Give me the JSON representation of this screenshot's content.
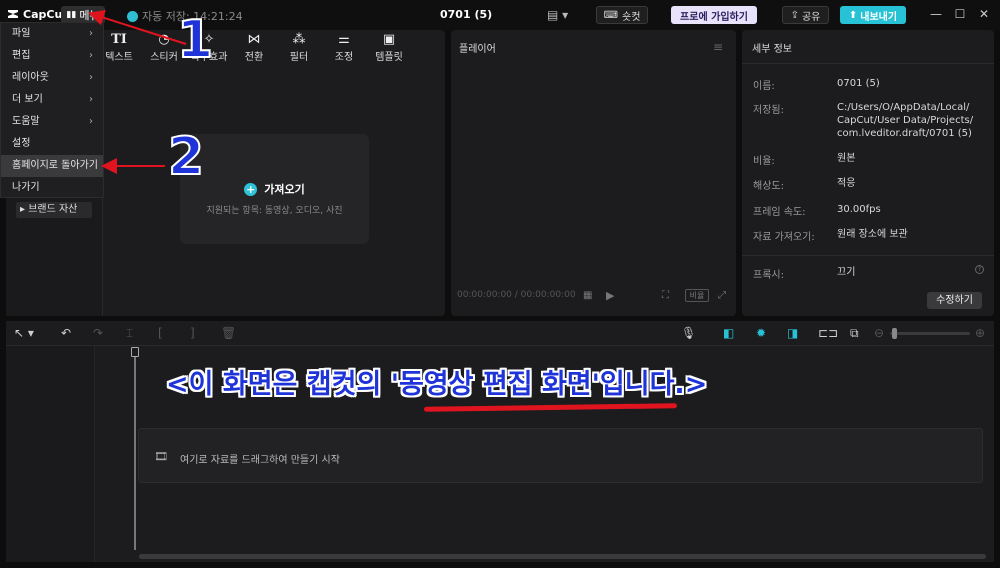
{
  "titlebar": {
    "logo": "CapCut",
    "menu_label": "메뉴",
    "autosave": "자동 저장: 14:21:24",
    "project_title": "0701 (5)",
    "shortcut_label": "숏컷",
    "pro_label": "프로에 가입하기",
    "share_label": "공유",
    "export_label": "내보내기"
  },
  "menu": {
    "items": [
      {
        "label": "파일",
        "has_sub": true
      },
      {
        "label": "편집",
        "has_sub": true
      },
      {
        "label": "레이아웃",
        "has_sub": true
      },
      {
        "label": "더 보기",
        "has_sub": true
      },
      {
        "label": "도움말",
        "has_sub": true
      },
      {
        "label": "설정",
        "has_sub": false
      },
      {
        "label": "홈페이지로 돌아가기",
        "has_sub": false
      },
      {
        "label": "나가기",
        "has_sub": false
      }
    ]
  },
  "media": {
    "tabs": [
      {
        "icon": "text-icon",
        "glyph": "TI",
        "label": "텍스트"
      },
      {
        "icon": "sticker-icon",
        "glyph": "◔",
        "label": "스티커"
      },
      {
        "icon": "effects-icon",
        "glyph": "✧",
        "label": "특수효과"
      },
      {
        "icon": "transition-icon",
        "glyph": "⋈",
        "label": "전환"
      },
      {
        "icon": "filter-icon",
        "glyph": "⁂",
        "label": "필터"
      },
      {
        "icon": "adjust-icon",
        "glyph": "⚌",
        "label": "조정"
      },
      {
        "icon": "template-icon",
        "glyph": "▣",
        "label": "템플릿"
      }
    ],
    "brand_asset": "▸ 브랜드 자산",
    "import_label": "가져오기",
    "import_hint": "지원되는 항목: 동영상, 오디오, 사진"
  },
  "player": {
    "title": "플레이어",
    "timecode": "00:00:00:00 / 00:00:00:00",
    "ratio_label": "비율"
  },
  "details": {
    "title": "세부 정보",
    "rows": [
      {
        "key": "이름:",
        "value": "0701 (5)"
      },
      {
        "key": "저장됨:",
        "value": "C:/Users/O/AppData/Local/\nCapCut/User Data/Projects/\ncom.lveditor.draft/0701 (5)"
      },
      {
        "key": "비율:",
        "value": "원본"
      },
      {
        "key": "해상도:",
        "value": "적응"
      },
      {
        "key": "프레임 속도:",
        "value": "30.00fps"
      },
      {
        "key": "자료 가져오기:",
        "value": "원래 장소에 보관"
      }
    ],
    "proxy_key": "프록시:",
    "proxy_value": "끄기",
    "edit_label": "수정하기"
  },
  "timeline": {
    "drop_text": "여기로 자료를 드래그하여 만들기 시작"
  },
  "annotations": {
    "num1": "1",
    "num2": "2",
    "caption": "<이 화면은 캡컷의 '동영상 편집 화면'입니다.>",
    "arrow_color": "#e0141e",
    "text_color": "#1e33d8"
  },
  "colors": {
    "accent": "#27c2d6",
    "background": "#0d0d0d",
    "panel": "#1c1c1e"
  }
}
